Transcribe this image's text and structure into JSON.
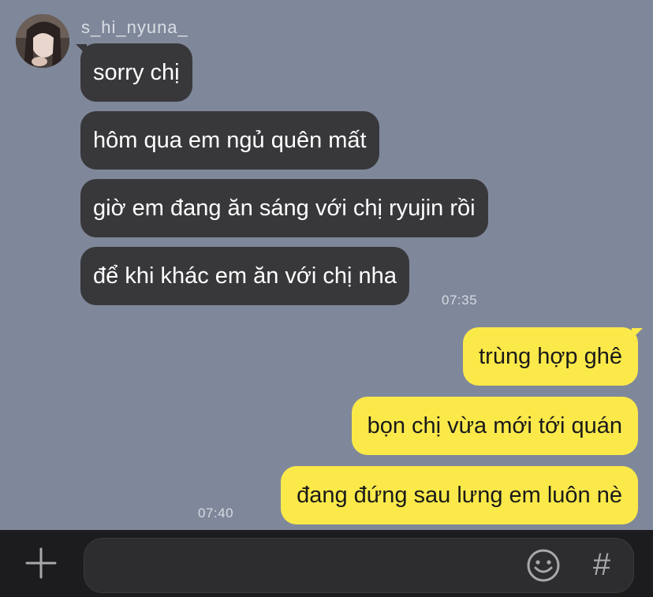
{
  "contact": {
    "name": "s_hi_nyuna_"
  },
  "messages_in": [
    {
      "text": "sorry chị"
    },
    {
      "text": "hôm qua em ngủ quên mất"
    },
    {
      "text": "giờ em đang ăn sáng với chị ryujin rồi"
    },
    {
      "text": "để khi khác em ăn với chị nha"
    }
  ],
  "time_in": "07:35",
  "messages_out": [
    {
      "text": "trùng hợp ghê"
    },
    {
      "text": "bọn chị vừa mới tới quán"
    },
    {
      "text": "đang đứng sau lưng em luôn nè"
    }
  ],
  "time_out": "07:40",
  "composer": {
    "placeholder": "",
    "hash_symbol": "#"
  },
  "colors": {
    "background": "#7f889a",
    "incoming_bubble": "#38383b",
    "outgoing_bubble": "#fbe94a",
    "composer_bar": "#1c1c1e"
  },
  "icons": {
    "add": "plus-icon",
    "emoji": "smiley-icon",
    "hashtag": "hash-icon",
    "avatar": "profile-photo"
  }
}
